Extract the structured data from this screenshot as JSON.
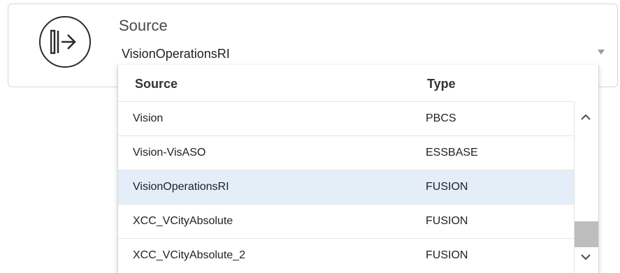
{
  "field": {
    "label": "Source",
    "value": "VisionOperationsRI",
    "icon": "source-arrow-icon"
  },
  "dropdown": {
    "headers": {
      "source": "Source",
      "type": "Type"
    },
    "rows": [
      {
        "source": "Vision",
        "type": "PBCS",
        "selected": false
      },
      {
        "source": "Vision-VisASO",
        "type": "ESSBASE",
        "selected": false
      },
      {
        "source": "VisionOperationsRI",
        "type": "FUSION",
        "selected": true
      },
      {
        "source": "XCC_VCityAbsolute",
        "type": "FUSION",
        "selected": false
      },
      {
        "source": "XCC_VCityAbsolute_2",
        "type": "FUSION",
        "selected": false
      }
    ]
  },
  "colors": {
    "selected_row": "#e4eef8",
    "scroll_thumb": "#bdbdbd",
    "icon_stroke": "#2b2b2b"
  }
}
